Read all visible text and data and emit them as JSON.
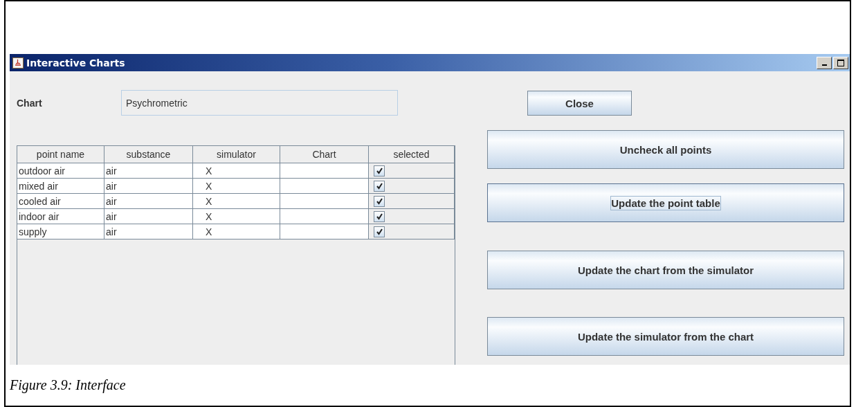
{
  "window": {
    "title": "Interactive Charts"
  },
  "chart_field": {
    "label": "Chart",
    "value": "Psychrometric"
  },
  "table": {
    "columns": [
      "point name",
      "substance",
      "simulator",
      "Chart",
      "selected"
    ],
    "rows": [
      {
        "point_name": "outdoor air",
        "substance": "air",
        "simulator": "X",
        "checked": true
      },
      {
        "point_name": "mixed air",
        "substance": "air",
        "simulator": "X",
        "checked": true
      },
      {
        "point_name": "cooled air",
        "substance": "air",
        "simulator": "X",
        "checked": true
      },
      {
        "point_name": "indoor air",
        "substance": "air",
        "simulator": "X",
        "checked": true
      },
      {
        "point_name": "supply",
        "substance": "air",
        "simulator": "X",
        "checked": true
      }
    ]
  },
  "buttons": [
    {
      "kind": "small",
      "label": "Close",
      "focused": false
    },
    {
      "kind": "wide",
      "label": "Uncheck all points",
      "focused": false
    },
    {
      "kind": "wide",
      "label": "Update the point table",
      "focused": true
    },
    {
      "kind": "wide",
      "label": "Update the chart from the simulator",
      "focused": false
    },
    {
      "kind": "wide",
      "label": "Update the simulator from the chart",
      "focused": false
    }
  ],
  "caption": "Figure 3.9: Interface"
}
